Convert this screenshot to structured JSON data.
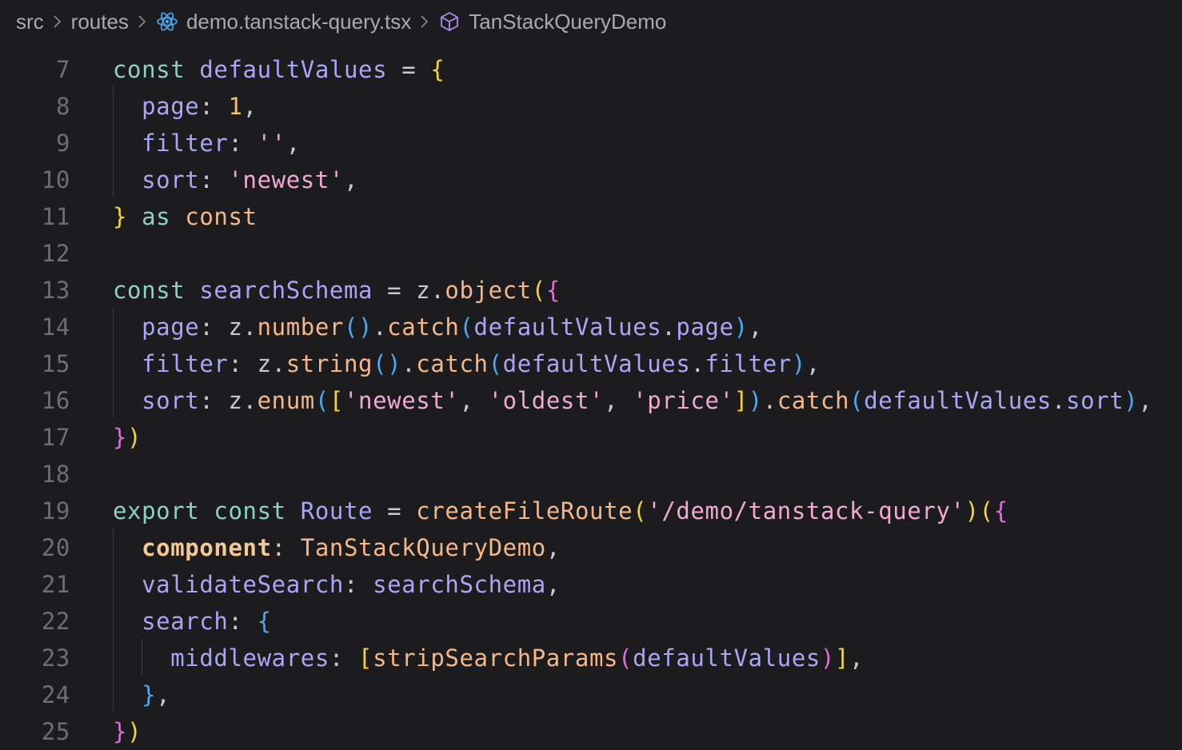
{
  "breadcrumb": {
    "items": [
      "src",
      "routes",
      "demo.tanstack-query.tsx",
      "TanStackQueryDemo"
    ]
  },
  "editor": {
    "line_numbers": [
      "7",
      "8",
      "9",
      "10",
      "11",
      "12",
      "13",
      "14",
      "15",
      "16",
      "17",
      "18",
      "19",
      "20",
      "21",
      "22",
      "23",
      "24",
      "25"
    ]
  },
  "colors": {
    "keyword": "#8fd0c4",
    "identifier": "#a9a6f5",
    "string": "#f0a9d4",
    "function": "#f4b78a",
    "bracket_level1": "#f5d33e",
    "bracket_level2": "#d870d8",
    "bracket_level3": "#4ea8f0"
  },
  "code": {
    "l7": [
      "const",
      "defaultValues",
      "=",
      "{"
    ],
    "l8": [
      "page",
      ":",
      "1",
      ","
    ],
    "l9": [
      "filter",
      ":",
      "''",
      ","
    ],
    "l10": [
      "sort",
      ":",
      "'newest'",
      ","
    ],
    "l11": [
      "}",
      "as",
      "const"
    ],
    "l13": [
      "const",
      "searchSchema",
      "=",
      "z",
      ".",
      "object",
      "(",
      "{"
    ],
    "l14": [
      "page",
      ":",
      "z",
      ".",
      "number",
      "(",
      ")",
      ".",
      "catch",
      "(",
      "defaultValues",
      ".",
      "page",
      ")",
      ","
    ],
    "l15": [
      "filter",
      ":",
      "z",
      ".",
      "string",
      "(",
      ")",
      ".",
      "catch",
      "(",
      "defaultValues",
      ".",
      "filter",
      ")",
      ","
    ],
    "l16": [
      "sort",
      ":",
      "z",
      ".",
      "enum",
      "(",
      "[",
      "'newest'",
      ",",
      "'oldest'",
      ",",
      "'price'",
      "]",
      ")",
      ".",
      "catch",
      "(",
      "defaultValues",
      ".",
      "sort",
      ")",
      ","
    ],
    "l17": [
      "}",
      ")"
    ],
    "l19": [
      "export",
      "const",
      "Route",
      "=",
      "createFileRoute",
      "(",
      "'/demo/tanstack-query'",
      ")",
      "(",
      "{"
    ],
    "l20": [
      "component",
      ":",
      "TanStackQueryDemo",
      ","
    ],
    "l21": [
      "validateSearch",
      ":",
      "searchSchema",
      ","
    ],
    "l22": [
      "search",
      ":",
      "{"
    ],
    "l23": [
      "middlewares",
      ":",
      "[",
      "stripSearchParams",
      "(",
      "defaultValues",
      ")",
      "]",
      ","
    ],
    "l24": [
      "}",
      ","
    ],
    "l25": [
      "}",
      ")"
    ]
  }
}
